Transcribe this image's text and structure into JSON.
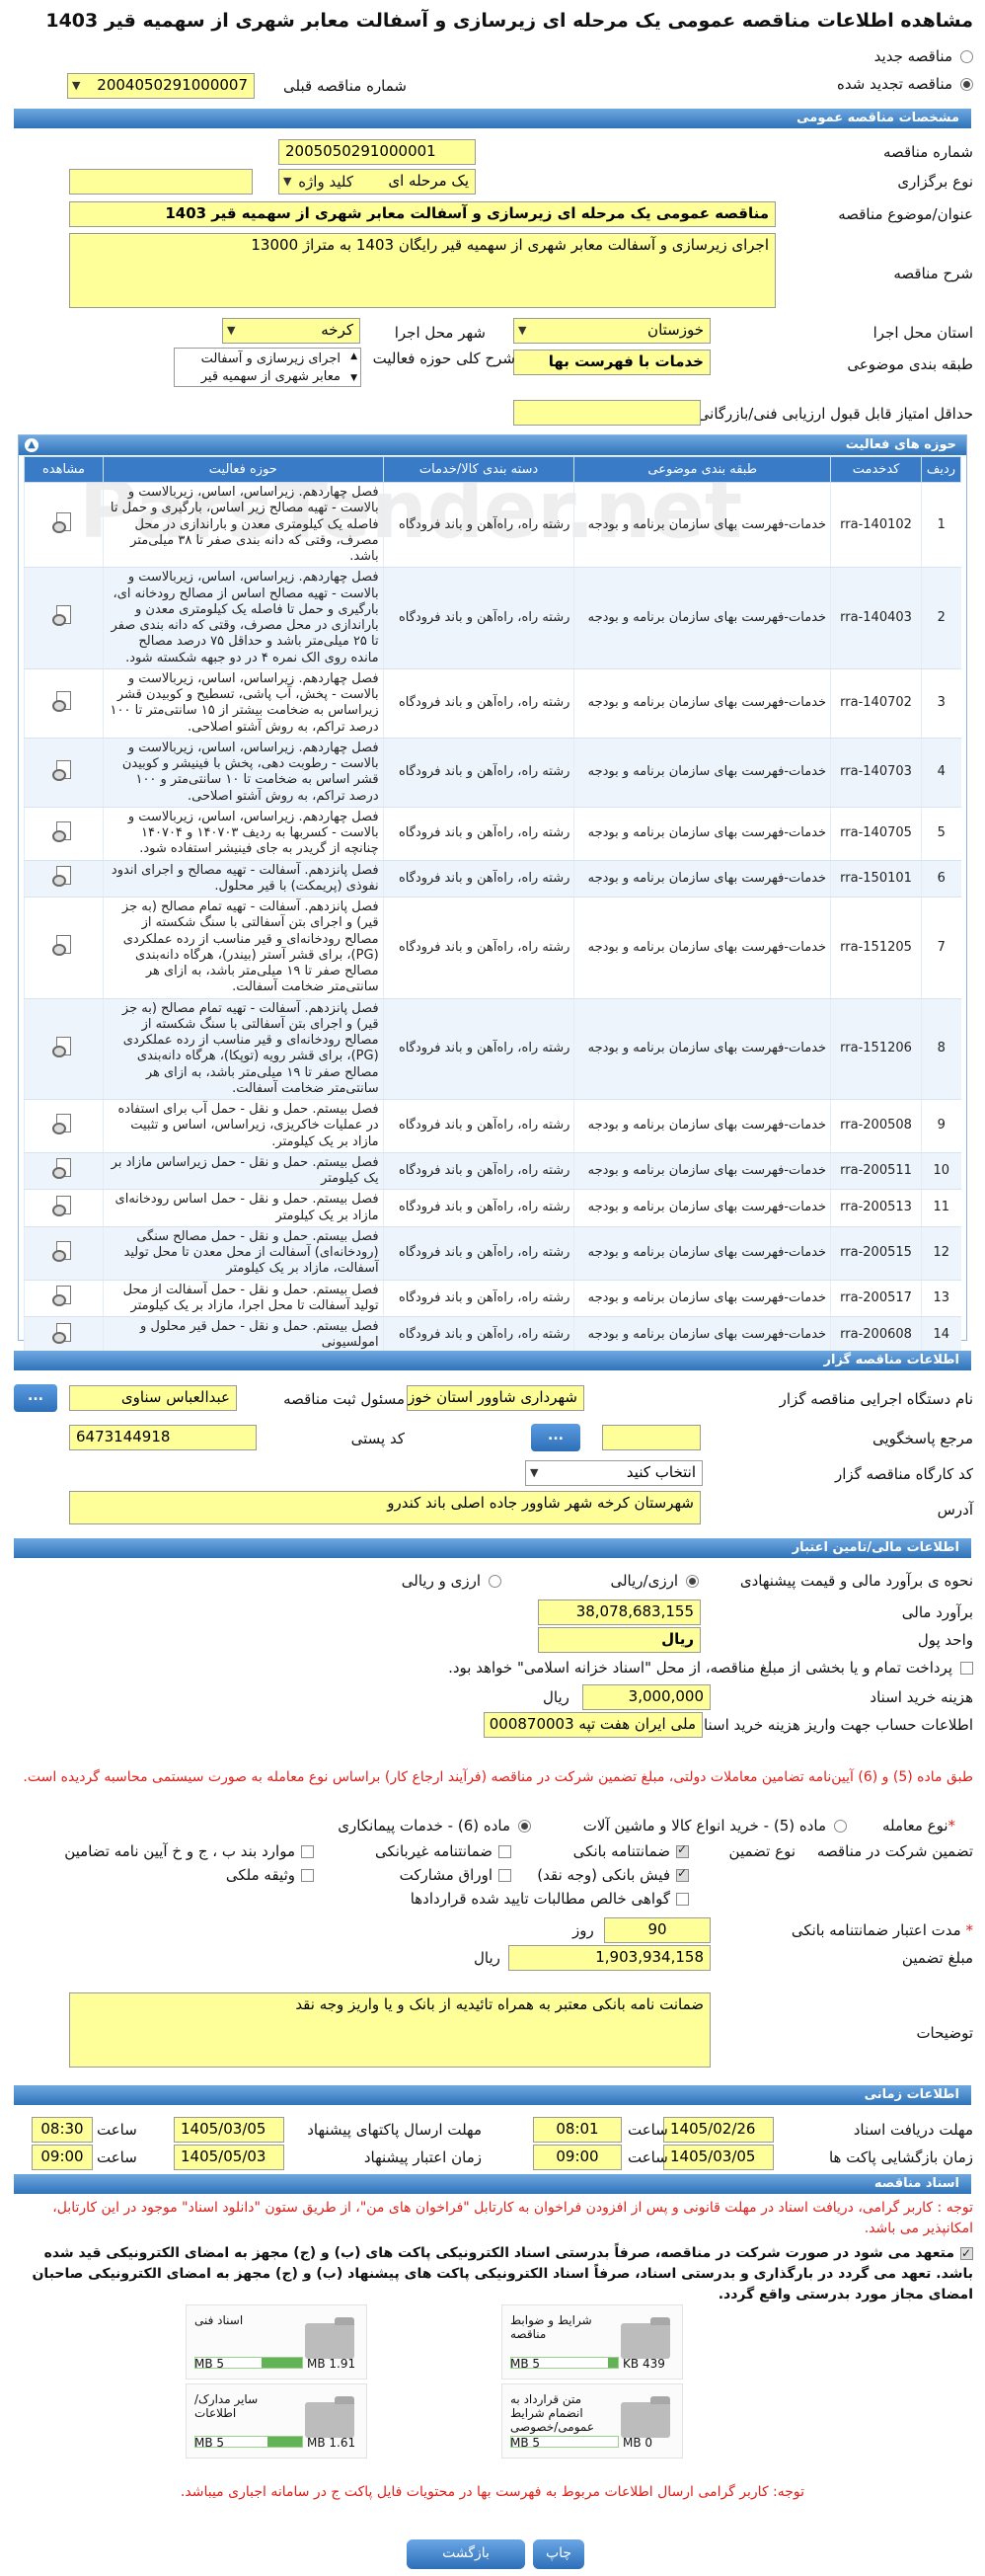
{
  "page": {
    "title": "مشاهده اطلاعات مناقصه عمومی یک مرحله ای زیرسازی و آسفالت معابر شهری از سهمیه قیر 1403",
    "radio_new": "مناقصه جدید",
    "radio_renewed": "مناقصه تجدید شده",
    "prev_number_label": "شماره مناقصه قبلی",
    "prev_number": "2004050291000007"
  },
  "general": {
    "header": "مشخصات مناقصه عمومی",
    "number_label": "شماره مناقصه",
    "number": "2005050291000001",
    "type_label": "نوع برگزاری",
    "type": "یک مرحله ای",
    "keyword_label": "کلید واژه",
    "subject_label": "عنوان/موضوع مناقصه",
    "subject": "مناقصه عمومی یک مرحله ای زیرسازی و آسفالت معابر شهری از سهمیه قیر 1403",
    "desc_label": "شرح مناقصه",
    "desc": "اجرای زیرسازی و آسفالت معابر شهری از سهمیه قیر رایگان 1403 به متراژ 13000",
    "province_label": "استان محل اجرا",
    "province": "خوزستان",
    "city_label": "شهر محل اجرا",
    "city": "کرخه",
    "category_label": "طبقه بندی موضوعی",
    "category": "خدمات با فهرست بها",
    "scope_label": "شرح کلی حوزه فعالیت",
    "scope": "اجرای زیرسازی و آسفالت معابر شهری از سهمیه قیر",
    "min_score_label": "حداقل امتیاز قابل قبول ارزیابی فنی/بازرگانی"
  },
  "activities": {
    "header": "حوزه های فعالیت",
    "columns": [
      "ردیف",
      "کدخدمت",
      "طبقه بندی موضوعی",
      "دسته بندی کالا/خدمات",
      "حوزه فعالیت",
      "مشاهده"
    ],
    "rows": [
      {
        "n": "1",
        "code": "rra-140102",
        "cat": "خدمات-فهرست بهای سازمان برنامه و بودجه",
        "group": "رشته راه، راه‌آهن و باند فرودگاه",
        "desc": "فصل چهاردهم. زیراساس، اساس، زیربالاست و بالاست - تهیه مصالح زیر اساس، بارگیری و حمل تا فاصله یک کیلومتری معدن و باراندازی در محل مصرف، وقتی که دانه بندی صفر تا ۳۸ میلی‌متر باشد."
      },
      {
        "n": "2",
        "code": "rra-140403",
        "cat": "خدمات-فهرست بهای سازمان برنامه و بودجه",
        "group": "رشته راه، راه‌آهن و باند فرودگاه",
        "desc": "فصل چهاردهم. زیراساس، اساس، زیربالاست و بالاست - تهیه مصالح اساس از مصالح رودخانه ای، بارگیری و حمل تا فاصله یک کیلومتری معدن و باراندازی در محل مصرف، وقتی که دانه بندی صفر تا ۲۵ میلی‌متر باشد و حداقل ۷۵ درصد مصالح مانده روی الک نمره ۴ در دو جبهه شکسته شود."
      },
      {
        "n": "3",
        "code": "rra-140702",
        "cat": "خدمات-فهرست بهای سازمان برنامه و بودجه",
        "group": "رشته راه، راه‌آهن و باند فرودگاه",
        "desc": "فصل چهاردهم. زیراساس، اساس، زیربالاست و بالاست - پخش، آب پاشی، تسطیح و کوبیدن قشر زیراساس به ضخامت بیشتر از ۱۵ سانتی‌متر تا ۱۰۰ درصد تراکم، به روش آشتو اصلاحی."
      },
      {
        "n": "4",
        "code": "rra-140703",
        "cat": "خدمات-فهرست بهای سازمان برنامه و بودجه",
        "group": "رشته راه، راه‌آهن و باند فرودگاه",
        "desc": "فصل چهاردهم. زیراساس، اساس، زیربالاست و بالاست - رطوبت دهی، پخش با فینیشر و کوبیدن قشر اساس به ضخامت تا ۱۰ سانتی‌متر و ۱۰۰ درصد تراکم، به روش آشتو اصلاحی."
      },
      {
        "n": "5",
        "code": "rra-140705",
        "cat": "خدمات-فهرست بهای سازمان برنامه و بودجه",
        "group": "رشته راه، راه‌آهن و باند فرودگاه",
        "desc": "فصل چهاردهم. زیراساس، اساس، زیربالاست و بالاست - کسربها به ردیف ۱۴۰۷۰۳ و ۱۴۰۷۰۴ چنانچه از گریدر به جای فینیشر استفاده شود."
      },
      {
        "n": "6",
        "code": "rra-150101",
        "cat": "خدمات-فهرست بهای سازمان برنامه و بودجه",
        "group": "رشته راه، راه‌آهن و باند فرودگاه",
        "desc": "فصل پانزدهم. آسفالت - تهیه مصالح و اجرای اندود نفوذی (پریمکت) با قیر محلول."
      },
      {
        "n": "7",
        "code": "rra-151205",
        "cat": "خدمات-فهرست بهای سازمان برنامه و بودجه",
        "group": "رشته راه، راه‌آهن و باند فرودگاه",
        "desc": "فصل پانزدهم. آسفالت - تهیه تمام مصالح (به جز قیر) و اجرای بتن آسفالتی با سنگ شکسته از مصالح رودخانه‌ای و قیر مناسب از رده عملکردی (PG)، برای قشر آستر (بیندر)، هرگاه دانه‌بندی مصالح صفر تا ۱۹ میلی‌متر باشد، به ازای هر سانتی‌متر ضخامت آسفالت."
      },
      {
        "n": "8",
        "code": "rra-151206",
        "cat": "خدمات-فهرست بهای سازمان برنامه و بودجه",
        "group": "رشته راه، راه‌آهن و باند فرودگاه",
        "desc": "فصل پانزدهم. آسفالت - تهیه تمام مصالح (به جز قیر) و اجرای بتن آسفالتی با سنگ شکسته از مصالح رودخانه‌ای و قیر مناسب از رده عملکردی (PG)، برای قشر رویه (توپکا)، هرگاه دانه‌بندی مصالح صفر تا ۱۹ میلی‌متر باشد، به ازای هر سانتی‌متر ضخامت آسفالت."
      },
      {
        "n": "9",
        "code": "rra-200508",
        "cat": "خدمات-فهرست بهای سازمان برنامه و بودجه",
        "group": "رشته راه، راه‌آهن و باند فرودگاه",
        "desc": "فصل بیستم. حمل و نقل - حمل آب برای استفاده در عملیات خاکریزی، زیراساس، اساس و تثبیت مازاد بر یک کیلومتر."
      },
      {
        "n": "10",
        "code": "rra-200511",
        "cat": "خدمات-فهرست بهای سازمان برنامه و بودجه",
        "group": "رشته راه، راه‌آهن و باند فرودگاه",
        "desc": "فصل بیستم. حمل و نقل - حمل زیراساس مازاد بر یک کیلومتر"
      },
      {
        "n": "11",
        "code": "rra-200513",
        "cat": "خدمات-فهرست بهای سازمان برنامه و بودجه",
        "group": "رشته راه، راه‌آهن و باند فرودگاه",
        "desc": "فصل بیستم. حمل و نقل - حمل اساس رودخانه‌ای مازاد بر یک کیلومتر"
      },
      {
        "n": "12",
        "code": "rra-200515",
        "cat": "خدمات-فهرست بهای سازمان برنامه و بودجه",
        "group": "رشته راه، راه‌آهن و باند فرودگاه",
        "desc": "فصل بیستم. حمل و نقل - حمل مصالح سنگی (رودخانه‌ای) آسفالت از محل معدن تا محل تولید آسفالت، مازاد بر یک کیلومتر"
      },
      {
        "n": "13",
        "code": "rra-200517",
        "cat": "خدمات-فهرست بهای سازمان برنامه و بودجه",
        "group": "رشته راه، راه‌آهن و باند فرودگاه",
        "desc": "فصل بیستم. حمل و نقل - حمل آسفالت از محل تولید آسفالت تا محل اجرا، مازاد بر یک کیلومتر"
      },
      {
        "n": "14",
        "code": "rra-200608",
        "cat": "خدمات-فهرست بهای سازمان برنامه و بودجه",
        "group": "رشته راه، راه‌آهن و باند فرودگاه",
        "desc": "فصل بیستم. حمل و نقل - حمل قیر محلول و امولسیونی"
      }
    ]
  },
  "organizer": {
    "header": "اطلاعات مناقصه گزار",
    "org_label": "نام دستگاه اجرایی مناقصه گزار",
    "org": "شهرداری شاوور استان خوز",
    "resp_label": "مسئول ثبت مناقصه",
    "resp": "عبدالعباس سناوی",
    "ref_label": "مرجع پاسخگویی",
    "postal_label": "کد پستی",
    "postal": "6473144918",
    "workshop_label": "کد کارگاه مناقصه گزار",
    "workshop": "انتخاب کنید",
    "address_label": "آدرس",
    "address": "شهرستان کرخه شهر شاوور جاده اصلی باند کندرو",
    "dots": "..."
  },
  "financial": {
    "header": "اطلاعات مالی/تامین اعتبار",
    "estimate_type_label": "نحوه ی برآورد مالی و قیمت پیشنهادی",
    "opt_rial_fx": "ارزی/ریالی",
    "opt_fx_and_rial": "ارزی و ریالی",
    "estimate_label": "برآورد مالی",
    "estimate": "38,078,683,155",
    "currency_label": "واحد پول",
    "currency": "ریال",
    "treasury_text": "پرداخت تمام و یا بخشی از مبلغ مناقصه، از محل \"اسناد خزانه اسلامی\" خواهد بود.",
    "doc_cost_label": "هزینه خرید اسناد",
    "doc_cost": "3,000,000",
    "doc_cost_unit": "ریال",
    "account_label": "اطلاعات حساب جهت واریز هزینه خرید اسناد",
    "account": "ملی ایران هفت تپه 000870003"
  },
  "guarantee": {
    "notice": "طبق ماده (5) و (6) آیین‌نامه تضامین معاملات دولتی، مبلغ تضمین شرکت در مناقصه (فرآیند ارجاع کار) براساس نوع معامله به صورت سیستمی محاسبه گردیده است.",
    "deal_type_label": "نوع معامله",
    "opt5": "ماده (5) - خرید انواع کالا و ماشین آلات",
    "opt6": "ماده (6) - خدمات پیمانکاری",
    "guarantee_label": "تضمین شرکت در مناقصه",
    "guarantee_type_label": "نوع تضمین",
    "g1": "ضمانتنامه بانکی",
    "g2": "ضمانتنامه غیربانکی",
    "g3": "موارد بند ب ، ج و خ آیین نامه تضامین",
    "g4": "فیش بانکی (وجه نقد)",
    "g5": "اوراق مشارکت",
    "g6": "وثیقه ملکی",
    "g7": "گواهی خالص مطالبات تایید شده قراردادها",
    "validity_label": "مدت اعتبار ضمانتنامه بانکی",
    "validity": "90",
    "validity_unit": "روز",
    "amount_label": "مبلغ تضمین",
    "amount": "1,903,934,158",
    "amount_unit": "ریال",
    "notes_label": "توضیحات",
    "notes": "ضمانت نامه بانکی معتبر به همراه تائیدیه از بانک و یا واریز وجه نقد"
  },
  "timing": {
    "header": "اطلاعات زمانی",
    "receive_label": "مهلت دریافت اسناد",
    "receive_date": "1405/02/26",
    "receive_time": "08:01",
    "send_label": "مهلت ارسال پاکتهای پیشنهاد",
    "send_date": "1405/03/05",
    "send_time": "08:30",
    "open_label": "زمان بازگشایی پاکت ها",
    "open_date": "1405/03/05",
    "open_time": "09:00",
    "valid_label": "زمان اعتبار پیشنهاد",
    "valid_date": "1405/05/03",
    "valid_time": "09:00",
    "time_label": "ساعت"
  },
  "docs": {
    "header": "اسناد مناقصه",
    "notice1": "توجه : کاربر گرامی، دریافت اسناد در مهلت قانونی و پس از افزودن فراخوان به کارتابل \"فراخوان های من\"، از طریق ستون \"دانلود اسناد\" موجود در این کارتابل، امکانپذیر می باشد.",
    "commit": "متعهد می شود در صورت شرکت در مناقصه، صرفاً بدرستی اسناد الکترونیکی پاکت های (ب) و (ج) مجهز به امضای الکترونیکی قید شده باشد. تعهد می گردد در بارگذاری و بدرستی اسناد، صرفاً اسناد الکترونیکی پاکت های پیشنهاد (ب) و (ج) مجهز به امضای الکترونیکی صاحبان امضای مجاز مورد بدرستی واقع گردد.",
    "files": [
      {
        "name": "شرایط و ضوابط مناقصه",
        "size": "439 KB",
        "max": "5 MB",
        "pct": 9
      },
      {
        "name": "اسناد فنی",
        "size": "1.91 MB",
        "max": "5 MB",
        "pct": 38
      },
      {
        "name": "متن قرارداد به انضمام شرایط عمومی/خصوصی",
        "size": "0 MB",
        "max": "5 MB",
        "pct": 0
      },
      {
        "name": "سایر مدارک/اطلاعات",
        "size": "1.61 MB",
        "max": "5 MB",
        "pct": 32
      }
    ],
    "notice2": "توجه: کاربر گرامی ارسال اطلاعات مربوط به فهرست بها در محتویات فایل پاکت ج در سامانه اجباری میباشد."
  },
  "buttons": {
    "print": "چاپ",
    "back": "بازگشت"
  },
  "watermark": "ParsTender.net"
}
